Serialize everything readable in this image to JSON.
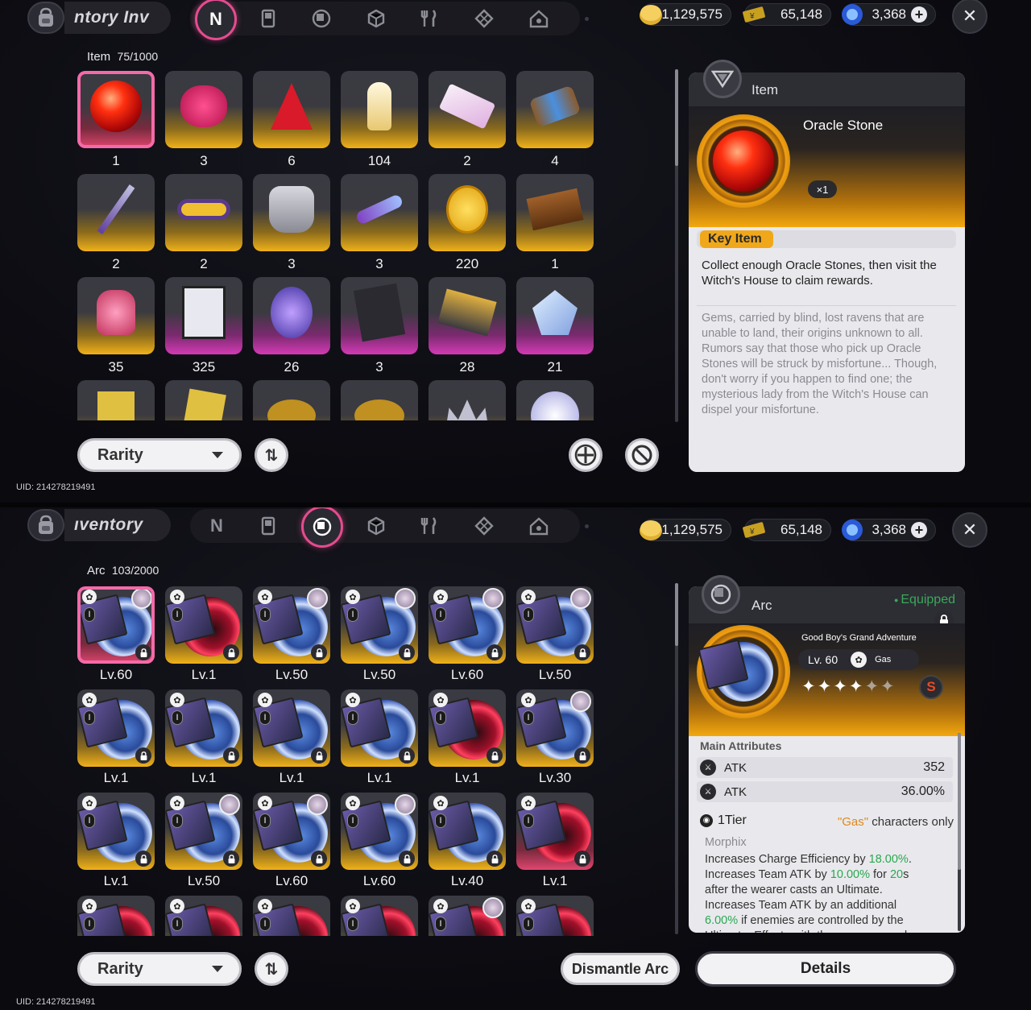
{
  "top": {
    "title": "ntory  Inv",
    "count_label": "Item",
    "count_value": "75/1000",
    "currencies": [
      {
        "icon": "gold-coin-icon",
        "value": "1,129,575"
      },
      {
        "icon": "ticket-icon",
        "value": "65,148"
      },
      {
        "icon": "blue-crystal-icon",
        "value": "3,368"
      }
    ],
    "tabs": [
      "item-tab",
      "device-tab",
      "arc-tab",
      "box-tab",
      "food-tab",
      "material-tab",
      "home-tab"
    ],
    "active_tab": 0,
    "items": [
      {
        "qty": "1",
        "rarity": "red",
        "art": "oracle-stone",
        "selected": true
      },
      {
        "qty": "3",
        "rarity": "gold",
        "art": "wax-seal"
      },
      {
        "qty": "6",
        "rarity": "gold",
        "art": "red-cloak"
      },
      {
        "qty": "104",
        "rarity": "gold",
        "art": "chess-piece"
      },
      {
        "qty": "2",
        "rarity": "gold",
        "art": "tickets"
      },
      {
        "qty": "4",
        "rarity": "gold",
        "art": "thread-spool"
      },
      {
        "qty": "2",
        "rarity": "gold",
        "art": "dagger"
      },
      {
        "qty": "2",
        "rarity": "gold",
        "art": "belt"
      },
      {
        "qty": "3",
        "rarity": "gold",
        "art": "armor"
      },
      {
        "qty": "3",
        "rarity": "gold",
        "art": "crystal-shard"
      },
      {
        "qty": "220",
        "rarity": "gold",
        "art": "gold-coin"
      },
      {
        "qty": "1",
        "rarity": "gold",
        "art": "book"
      },
      {
        "qty": "35",
        "rarity": "gold",
        "art": "gift-bag"
      },
      {
        "qty": "325",
        "rarity": "purple",
        "art": "document"
      },
      {
        "qty": "26",
        "rarity": "purple",
        "art": "egg"
      },
      {
        "qty": "3",
        "rarity": "purple",
        "art": "dark-book"
      },
      {
        "qty": "28",
        "rarity": "purple",
        "art": "map-box"
      },
      {
        "qty": "21",
        "rarity": "purple",
        "art": "gems"
      },
      {
        "qty": "",
        "rarity": "gold",
        "art": "card"
      },
      {
        "qty": "",
        "rarity": "gold",
        "art": "card2"
      },
      {
        "qty": "",
        "rarity": "gold",
        "art": "coin-stack"
      },
      {
        "qty": "",
        "rarity": "gold",
        "art": "coin-stack2"
      },
      {
        "qty": "",
        "rarity": "gold",
        "art": "crown"
      },
      {
        "qty": "",
        "rarity": "gold",
        "art": "orb"
      }
    ],
    "rarity_label": "Rarity",
    "uid": "UID: 214278219491",
    "detail": {
      "header": "Item",
      "name": "Oracle Stone",
      "multiplier": "×1",
      "tag": "Key Item",
      "description": "Collect enough Oracle Stones, then visit the Witch's House to claim rewards.",
      "lore": "Gems, carried by blind, lost ravens that are unable to land, their origins unknown to all. Rumors say that those who pick up Oracle Stones will be struck by misfortune... Though, don't worry if you happen to find one; the mysterious lady from the Witch's House can dispel your misfortune."
    }
  },
  "bottom": {
    "title": "ıventory",
    "count_label": "Arc",
    "count_value": "103/2000",
    "currencies": [
      {
        "icon": "gold-coin-icon",
        "value": "1,129,575"
      },
      {
        "icon": "ticket-icon",
        "value": "65,148"
      },
      {
        "icon": "blue-crystal-icon",
        "value": "3,368"
      }
    ],
    "active_tab": 2,
    "arcs": [
      {
        "lv": "Lv.60",
        "rarity": "red",
        "selected": true,
        "disc": "blue",
        "portrait": true
      },
      {
        "lv": "Lv.1",
        "rarity": "gold",
        "disc": "red",
        "portrait": false
      },
      {
        "lv": "Lv.50",
        "rarity": "gold",
        "disc": "blue",
        "portrait": true
      },
      {
        "lv": "Lv.50",
        "rarity": "gold",
        "disc": "blue",
        "portrait": true
      },
      {
        "lv": "Lv.60",
        "rarity": "gold",
        "disc": "blue",
        "portrait": true
      },
      {
        "lv": "Lv.50",
        "rarity": "gold",
        "disc": "blue",
        "portrait": true
      },
      {
        "lv": "Lv.1",
        "rarity": "gold",
        "disc": "blue",
        "portrait": false
      },
      {
        "lv": "Lv.1",
        "rarity": "gold",
        "disc": "blue",
        "portrait": false
      },
      {
        "lv": "Lv.1",
        "rarity": "gold",
        "disc": "blue",
        "portrait": false
      },
      {
        "lv": "Lv.1",
        "rarity": "gold",
        "disc": "blue",
        "portrait": false
      },
      {
        "lv": "Lv.1",
        "rarity": "gold",
        "disc": "red",
        "portrait": false
      },
      {
        "lv": "Lv.30",
        "rarity": "gold",
        "disc": "blue",
        "portrait": true
      },
      {
        "lv": "Lv.1",
        "rarity": "gold",
        "disc": "blue",
        "portrait": false
      },
      {
        "lv": "Lv.50",
        "rarity": "gold",
        "disc": "blue",
        "portrait": true
      },
      {
        "lv": "Lv.60",
        "rarity": "gold",
        "disc": "blue",
        "portrait": true
      },
      {
        "lv": "Lv.60",
        "rarity": "gold",
        "disc": "blue",
        "portrait": true
      },
      {
        "lv": "Lv.40",
        "rarity": "gold",
        "disc": "blue",
        "portrait": false
      },
      {
        "lv": "Lv.1",
        "rarity": "red",
        "disc": "red",
        "portrait": false
      },
      {
        "lv": "",
        "rarity": "gold",
        "disc": "red",
        "portrait": false
      },
      {
        "lv": "",
        "rarity": "gold",
        "disc": "red",
        "portrait": false
      },
      {
        "lv": "",
        "rarity": "gold",
        "disc": "red",
        "portrait": false
      },
      {
        "lv": "",
        "rarity": "gold",
        "disc": "red",
        "portrait": false
      },
      {
        "lv": "",
        "rarity": "gold",
        "disc": "red",
        "portrait": true
      },
      {
        "lv": "",
        "rarity": "gold",
        "disc": "red",
        "portrait": false
      }
    ],
    "rarity_label": "Rarity",
    "dismantle_label": "Dismantle Arc",
    "uid": "UID: 214278219491",
    "detail": {
      "header": "Arc",
      "equipped": "Equipped",
      "name": "Good Boy's Grand Adventure",
      "level": "Lv. 60",
      "element": "Gas",
      "stars_on": 4,
      "stars_total": 6,
      "main_attr_title": "Main Attributes",
      "attrs": [
        {
          "name": "ATK",
          "value": "352"
        },
        {
          "name": "ATK",
          "value": "36.00%"
        }
      ],
      "tier": "1Tier",
      "only_prefix": "\"Gas\"",
      "only_suffix": " characters only",
      "morph_title": "Morphix",
      "morph_lines": [
        {
          "text": "Increases Charge Efficiency by ",
          "hl": "18.00%",
          "tail": "."
        },
        {
          "text": "Increases Team ATK by ",
          "hl": "10.00%",
          "tail": " for ",
          "hl2": "20",
          "tail2": "s"
        },
        {
          "text": "after the wearer casts an Ultimate.",
          "hl": "",
          "tail": ""
        },
        {
          "text": "Increases Team ATK by an additional",
          "hl": "",
          "tail": ""
        },
        {
          "text": "",
          "hl": "6.00%",
          "tail": " if enemies are controlled by the"
        },
        {
          "text": "Ultimate. Effects with the same name do",
          "hl": "",
          "tail": ""
        }
      ],
      "details_label": "Details"
    }
  }
}
